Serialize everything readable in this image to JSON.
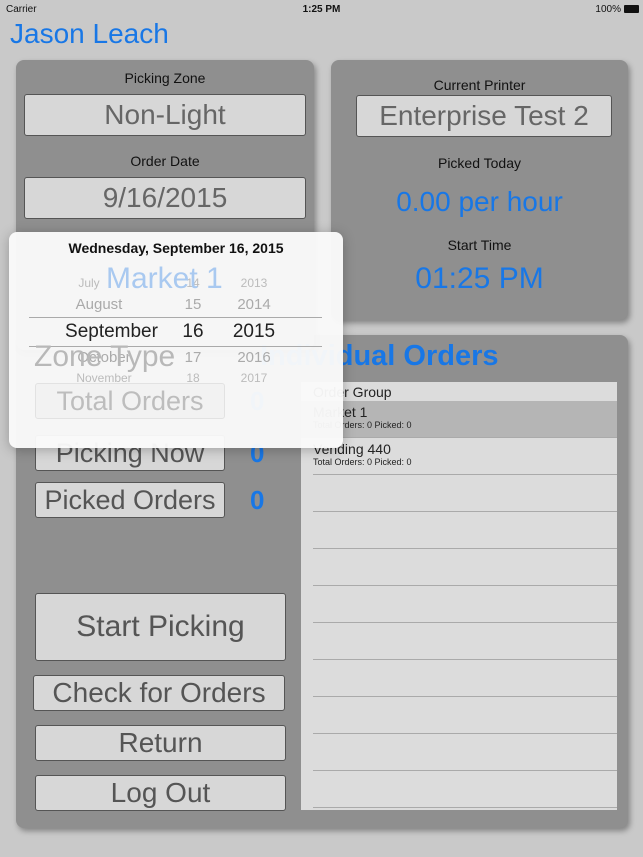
{
  "status": {
    "carrier": "Carrier",
    "time": "1:25 PM",
    "battery": "100%"
  },
  "user_name": "Jason Leach",
  "picking_zone": {
    "label": "Picking Zone",
    "value": "Non-Light"
  },
  "order_date": {
    "label": "Order Date",
    "value": "9/16/2015"
  },
  "zone": {
    "value": "Market 1",
    "label": "Zone Type"
  },
  "printer": {
    "label": "Current Printer",
    "value": "Enterprise Test 2"
  },
  "picked_today": {
    "label": "Picked Today",
    "value": "0.00 per hour"
  },
  "start_time": {
    "label": "Start Time",
    "value": "01:25 PM"
  },
  "stats": [
    {
      "label": "Total Orders",
      "value": "0"
    },
    {
      "label": "Picking Now",
      "value": "0"
    },
    {
      "label": "Picked Orders",
      "value": "0"
    }
  ],
  "buttons": {
    "start": "Start Picking",
    "check": "Check for Orders",
    "return": "Return",
    "logout": "Log Out"
  },
  "orders": {
    "title": "Individual Orders",
    "header": "Order Group",
    "items": [
      {
        "name": "Market 1",
        "detail": "Total Orders: 0 Picked: 0",
        "selected": true
      },
      {
        "name": "Vending 440",
        "detail": "Total Orders: 0 Picked: 0",
        "selected": false
      }
    ]
  },
  "date_picker": {
    "title": "Wednesday, September 16, 2015",
    "months": [
      "July",
      "August",
      "September",
      "October",
      "November"
    ],
    "days": [
      "14",
      "15",
      "16",
      "17",
      "18"
    ],
    "years": [
      "2013",
      "2014",
      "2015",
      "2016",
      "2017"
    ],
    "selected_index": 2
  },
  "colors": {
    "accent": "#1877e6",
    "panel": "#8f8f8f"
  }
}
